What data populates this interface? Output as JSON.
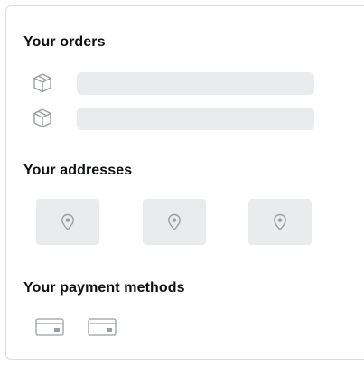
{
  "orders": {
    "title": "Your orders",
    "icon": "package-box-icon",
    "rows": [
      {
        "icon": "package-box-icon"
      },
      {
        "icon": "package-box-icon"
      }
    ]
  },
  "addresses": {
    "title": "Your addresses",
    "icon": "location-pin-icon",
    "tiles": 3
  },
  "payments": {
    "title": "Your payment methods",
    "icon": "credit-card-icon",
    "cards": 2
  },
  "colors": {
    "title_text": "#0f1111",
    "skeleton": "#e9ebec",
    "icon_stroke": "#9a9fa3",
    "card_border": "#dcdcdc"
  }
}
